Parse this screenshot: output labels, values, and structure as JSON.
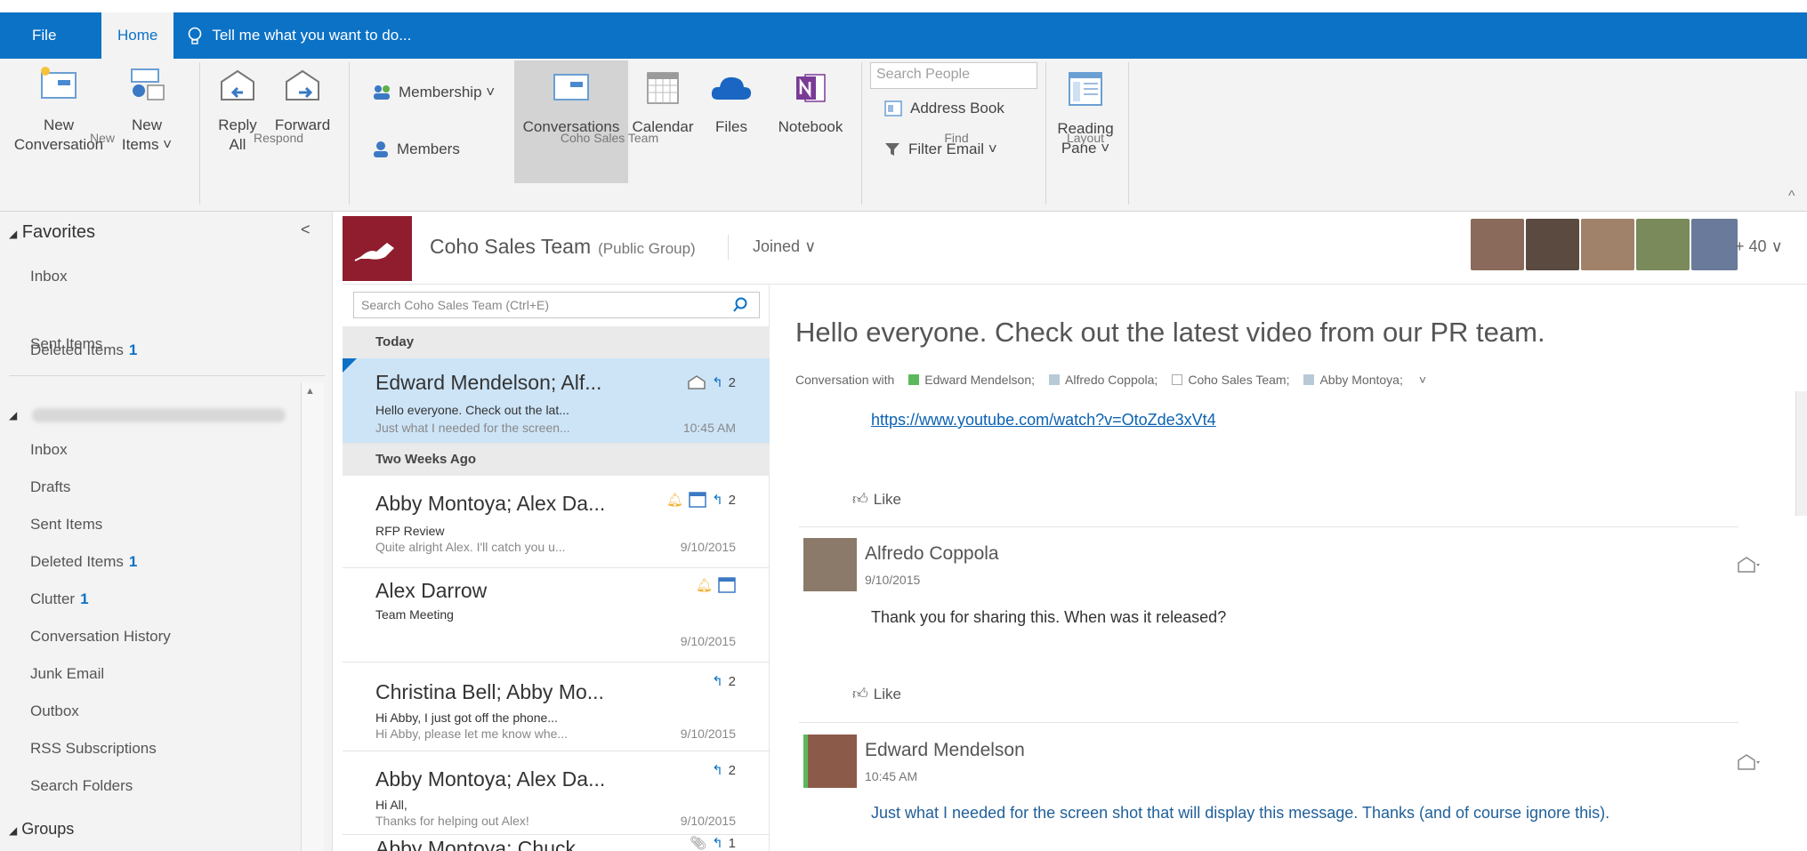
{
  "menu": {
    "file": "File",
    "home": "Home",
    "tellme": "Tell me what you want to do..."
  },
  "ribbon": {
    "new_conversation": "New\nConversation",
    "new_conversation_l1": "New",
    "new_conversation_l2": "Conversation",
    "new_items_l1": "New",
    "new_items_l2": "Items ˅",
    "reply_all_l1": "Reply",
    "reply_all_l2": "All",
    "forward": "Forward",
    "membership": "Membership ˅",
    "members": "Members",
    "conversations": "Conversations",
    "calendar": "Calendar",
    "files": "Files",
    "notebook": "Notebook",
    "search_people_placeholder": "Search People",
    "address_book": "Address Book",
    "filter_email": "Filter Email ˅",
    "reading_pane_l1": "Reading",
    "reading_pane_l2": "Pane ˅",
    "groups": {
      "new": "New",
      "respond": "Respond",
      "coho": "Coho Sales Team",
      "find": "Find",
      "layout": "Layout"
    }
  },
  "nav": {
    "favorites": "Favorites",
    "fav_items": [
      {
        "label": "Inbox",
        "count": ""
      },
      {
        "label": "Sent Items",
        "count": ""
      },
      {
        "label": "Deleted Items",
        "count": "1"
      }
    ],
    "account_items": [
      {
        "label": "Inbox",
        "count": ""
      },
      {
        "label": "Drafts",
        "count": ""
      },
      {
        "label": "Sent Items",
        "count": ""
      },
      {
        "label": "Deleted Items",
        "count": "1"
      },
      {
        "label": "Clutter",
        "count": "1"
      },
      {
        "label": "Conversation History",
        "count": ""
      },
      {
        "label": "Junk Email",
        "count": ""
      },
      {
        "label": "Outbox",
        "count": ""
      },
      {
        "label": "RSS Subscriptions",
        "count": ""
      },
      {
        "label": "Search Folders",
        "count": ""
      }
    ],
    "groups": "Groups"
  },
  "group": {
    "name": "Coho Sales Team",
    "type": "(Public Group)",
    "joined": "Joined",
    "more_members": "+ 40",
    "search_placeholder": "Search Coho Sales Team (Ctrl+E)"
  },
  "list": {
    "today": "Today",
    "two_weeks": "Two Weeks Ago",
    "items": [
      {
        "sender": "Edward Mendelson; Alf...",
        "subject": "Hello everyone. Check out the lat...",
        "preview": "Just what I needed for the screen...",
        "date": "10:45 AM",
        "count": "2"
      },
      {
        "sender": "Abby Montoya; Alex Da...",
        "subject": "RFP Review",
        "preview": "Quite alright Alex. I'll catch you u...",
        "date": "9/10/2015",
        "count": "2"
      },
      {
        "sender": "Alex Darrow",
        "subject": "Team Meeting",
        "preview": "",
        "date": "9/10/2015",
        "count": ""
      },
      {
        "sender": "Christina Bell; Abby Mo...",
        "subject": "Hi Abby, I just got off the phone...",
        "preview": "Hi Abby, please let me know whe...",
        "date": "9/10/2015",
        "count": "2"
      },
      {
        "sender": "Abby Montoya; Alex Da...",
        "subject": "Hi All,",
        "preview": "Thanks for helping out Alex!",
        "date": "9/10/2015",
        "count": "2"
      },
      {
        "sender": "Abby Montoya; Chuck...",
        "subject": "",
        "preview": "",
        "date": "",
        "count": "1"
      }
    ]
  },
  "reading": {
    "title": "Hello everyone. Check out the latest video from our PR team.",
    "conv_with": "Conversation with",
    "participants": [
      "Edward Mendelson;",
      "Alfredo Coppola;",
      "Coho Sales Team;",
      "Abby Montoya;"
    ],
    "link": "https://www.youtube.com/watch?v=OtoZde3xVt4",
    "like": "Like",
    "posts": [
      {
        "name": "Alfredo Coppola",
        "date": "9/10/2015",
        "body": "Thank you for sharing this. When was it released?"
      },
      {
        "name": "Edward Mendelson",
        "date": "10:45 AM",
        "body": "Just what I needed for the screen shot that will display this message. Thanks (and of course ignore this)."
      }
    ]
  },
  "colors": {
    "brand_blue": "#0b72c6",
    "selected_row": "#cde4f7",
    "group_logo": "#8f1d2e"
  }
}
